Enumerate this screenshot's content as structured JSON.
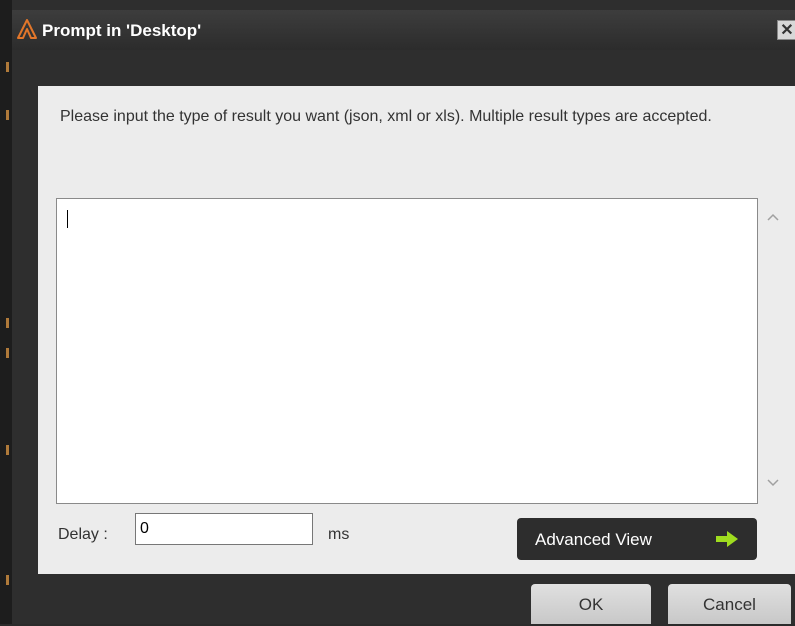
{
  "window": {
    "title": "Prompt in 'Desktop'",
    "close_glyph": "✕"
  },
  "dialog": {
    "message": "Please input the type of result you want (json, xml or xls). Multiple result types are accepted.",
    "input_value": "",
    "delay_label": "Delay :",
    "delay_value": "0",
    "delay_unit": "ms",
    "advanced_label": "Advanced View",
    "ok_label": "OK",
    "cancel_label": "Cancel"
  },
  "icons": {
    "app": "app-logo-icon",
    "close": "close-icon",
    "scroll_up": "chevron-up-icon",
    "scroll_down": "chevron-down-icon",
    "advanced": "arrow-right-icon"
  },
  "colors": {
    "panel": "#ececec",
    "frame": "#2e2e2e",
    "arrow": "#9fdc1f",
    "logo": "#e2762a"
  }
}
